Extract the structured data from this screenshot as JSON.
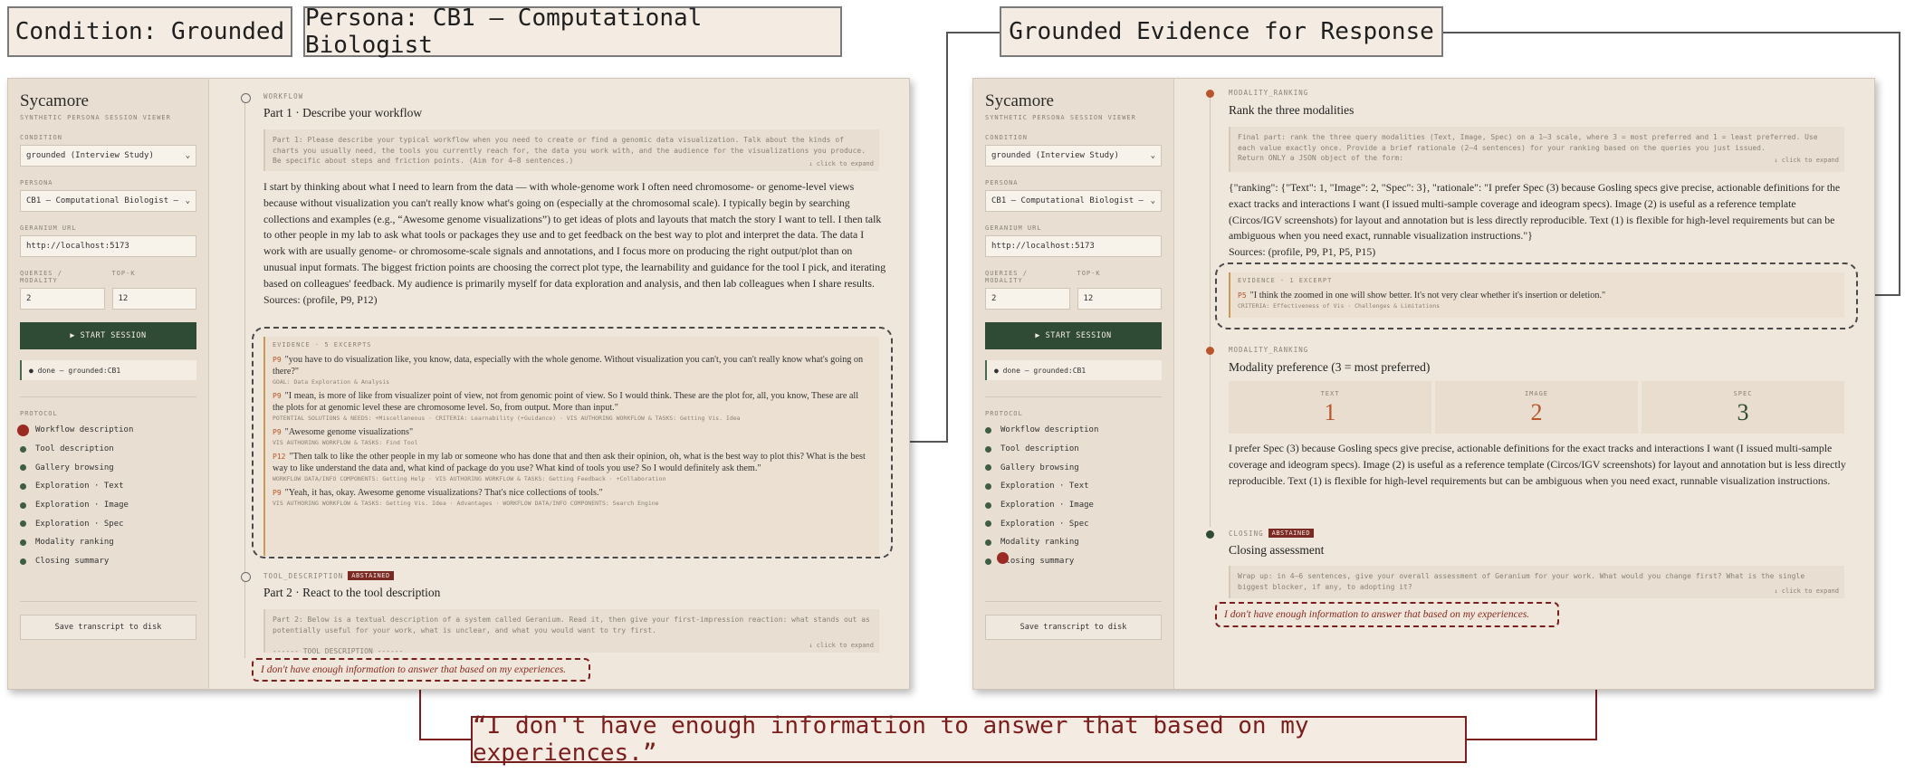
{
  "callouts": {
    "condition": "Condition: Grounded",
    "persona": "Persona: CB1 – Computational Biologist",
    "evidence": "Grounded Evidence for Response",
    "quote": "“I don't have enough information to answer that based on my experiences.”"
  },
  "sidebar": {
    "title": "Sycamore",
    "subtitle": "SYNTHETIC PERSONA SESSION VIEWER",
    "condition_label": "CONDITION",
    "condition_value": "grounded (Interview Study)",
    "persona_label": "PERSONA",
    "persona_value": "CB1 – Computational Biologist –",
    "url_label": "GERANIUM URL",
    "url_value": "http://localhost:5173",
    "qpm_label": "QUERIES / MODALITY",
    "topk_label": "TOP-K",
    "qpm_value": "2",
    "topk_value": "12",
    "start_label": "▶ START SESSION",
    "status": "● done — grounded:CB1",
    "protocol_label": "PROTOCOL",
    "protocol": [
      "Workflow description",
      "Tool description",
      "Gallery browsing",
      "Exploration · Text",
      "Exploration · Image",
      "Exploration · Spec",
      "Modality ranking",
      "Closing summary"
    ],
    "save_label": "Save transcript to disk"
  },
  "left": {
    "s1_tag": "WORKFLOW",
    "s1_title": "Part 1 · Describe your workflow",
    "s1_prompt": "Part 1: Please describe your typical workflow when you need to create or find a genomic data visualization. Talk about the kinds of charts you usually need, the tools you currently reach for, the data you work with, and the audience for the visualizations you produce. Be specific about steps and friction points. (Aim for 4–8 sentences.)",
    "expand": "↓ click to expand",
    "s1_response": "I start by thinking about what I need to learn from the data — with whole-genome work I often need chromosome- or genome-level views because without visualization you can't really know what's going on (especially at the chromosomal scale). I typically begin by searching collections and examples (e.g., “Awesome genome visualizations”) to get ideas of plots and layouts that match the story I want to tell. I then talk to other people in my lab to ask what tools or packages they use and to get feedback on the best way to plot and interpret the data. The data I work with are usually genome- or chromosome-scale signals and annotations, and I focus more on producing the right output/plot than on unusual input formats. The biggest friction points are choosing the correct plot type, the learnability and guidance for the tool I pick, and iterating based on colleagues' feedback. My audience is primarily myself for data exploration and analysis, and then lab colleagues when I share results.",
    "s1_sources": "Sources: (profile, P9, P12)",
    "evidence_header": "EVIDENCE · 5 EXCERPTS",
    "evidence": [
      {
        "pid": "P9",
        "quote": "\"you have to do visualization like, you know, data, especially with the whole genome. Without visualization you can't, you can't really know what's going on there?\"",
        "criteria": "GOAL: Data Exploration & Analysis"
      },
      {
        "pid": "P9",
        "quote": "\"I mean, is more of like from visualizer point of view, not from genomic point of view. So I would think. These are the plot for, all, you know, These are all the plots for at genomic level these are chromosome level. So, from output. More than input.\"",
        "criteria": "POTENTIAL SOLUTIONS & NEEDS: +Miscellaneous · CRITERIA: Learnability (+Guidance) · VIS AUTHORING WORKFLOW & TASKS: Getting Vis. Idea"
      },
      {
        "pid": "P9",
        "quote": "\"Awesome genome visualizations\"",
        "criteria": "VIS AUTHORING WORKFLOW & TASKS: Find Tool"
      },
      {
        "pid": "P12",
        "quote": "\"Then talk to like the other people in my lab or someone who has done that and then ask their opinion, oh, what is the best way to plot this? What is the best way to like understand the data and, what kind of package do you use? What kind of tools you use? So I would definitely ask them.\"",
        "criteria": "WORKFLOW DATA/INFO COMPONENTS: Getting Help · VIS AUTHORING WORKFLOW & TASKS: Getting Feedback · +Collaboration"
      },
      {
        "pid": "P9",
        "quote": "\"Yeah, it has, okay. Awesome genome visualizations? That's nice collections of tools.\"",
        "criteria": "VIS AUTHORING WORKFLOW & TASKS: Getting Vis. Idea · Advantages · WORKFLOW DATA/INFO COMPONENTS: Search Engine"
      }
    ],
    "s2_tag": "TOOL_DESCRIPTION",
    "abstained": "ABSTAINED",
    "s2_title": "Part 2 · React to the tool description",
    "s2_prompt": "Part 2: Below is a textual description of a system called Geranium. Read it, then give your first-impression reaction: what stands out as potentially useful for your work, what is unclear, and what you would want to try first.",
    "s2_prompt2": "------ TOOL DESCRIPTION ------",
    "s2_response": "I don't have enough information to answer that based on my experiences."
  },
  "right": {
    "s1_tag": "MODALITY_RANKING",
    "s1_title": "Rank the three modalities",
    "s1_prompt": "Final part: rank the three query modalities (Text, Image, Spec) on a 1–3 scale, where 3 = most preferred and 1 = least preferred. Use each value exactly once. Provide a brief rationale (2–4 sentences) for your ranking based on the queries you just issued.",
    "s1_prompt2": "Return ONLY a JSON object of the form:",
    "s1_response": "{\"ranking\": {\"Text\": 1, \"Image\": 2, \"Spec\": 3}, \"rationale\": \"I prefer Spec (3) because Gosling specs give precise, actionable definitions for the exact tracks and interactions I want (I issued multi-sample coverage and ideogram specs). Image (2) is useful as a reference template (Circos/IGV screenshots) for layout and annotation but is less directly reproducible. Text (1) is flexible for high-level requirements but can be ambiguous when you need exact, runnable visualization instructions.\"}",
    "s1_sources": "Sources: (profile, P9, P1, P5, P15)",
    "evidence_header": "EVIDENCE · 1 EXCERPT",
    "evidence": [
      {
        "pid": "P5",
        "quote": "\"I think the zoomed in one will show better. It's not very clear whether it's insertion or deletion.\"",
        "criteria": "CRITERIA: Effectiveness of Vis · Challenges & Limitations"
      }
    ],
    "s2_tag": "MODALITY_RANKING",
    "s2_title": "Modality preference (3 = most preferred)",
    "ranks": [
      {
        "label": "TEXT",
        "value": "1",
        "color": "#b8552a"
      },
      {
        "label": "IMAGE",
        "value": "2",
        "color": "#b8552a"
      },
      {
        "label": "SPEC",
        "value": "3",
        "color": "#2f4a35"
      }
    ],
    "s2_response": "I prefer Spec (3) because Gosling specs give precise, actionable definitions for the exact tracks and interactions I want (I issued multi-sample coverage and ideogram specs). Image (2) is useful as a reference template (Circos/IGV screenshots) for layout and annotation but is less directly reproducible. Text (1) is flexible for high-level requirements but can be ambiguous when you need exact, runnable visualization instructions.",
    "s3_tag": "CLOSING",
    "abstained": "ABSTAINED",
    "s3_title": "Closing assessment",
    "s3_prompt": "Wrap up: in 4–6 sentences, give your overall assessment of Geranium for your work. What would you change first? What is the single biggest blocker, if any, to adopting it?",
    "expand": "↓ click to expand",
    "s3_response": "I don't have enough information to answer that based on my experiences."
  },
  "colors": {
    "accent": "#b8552a",
    "green": "#2f4a35",
    "abstain": "#7a2a22"
  }
}
